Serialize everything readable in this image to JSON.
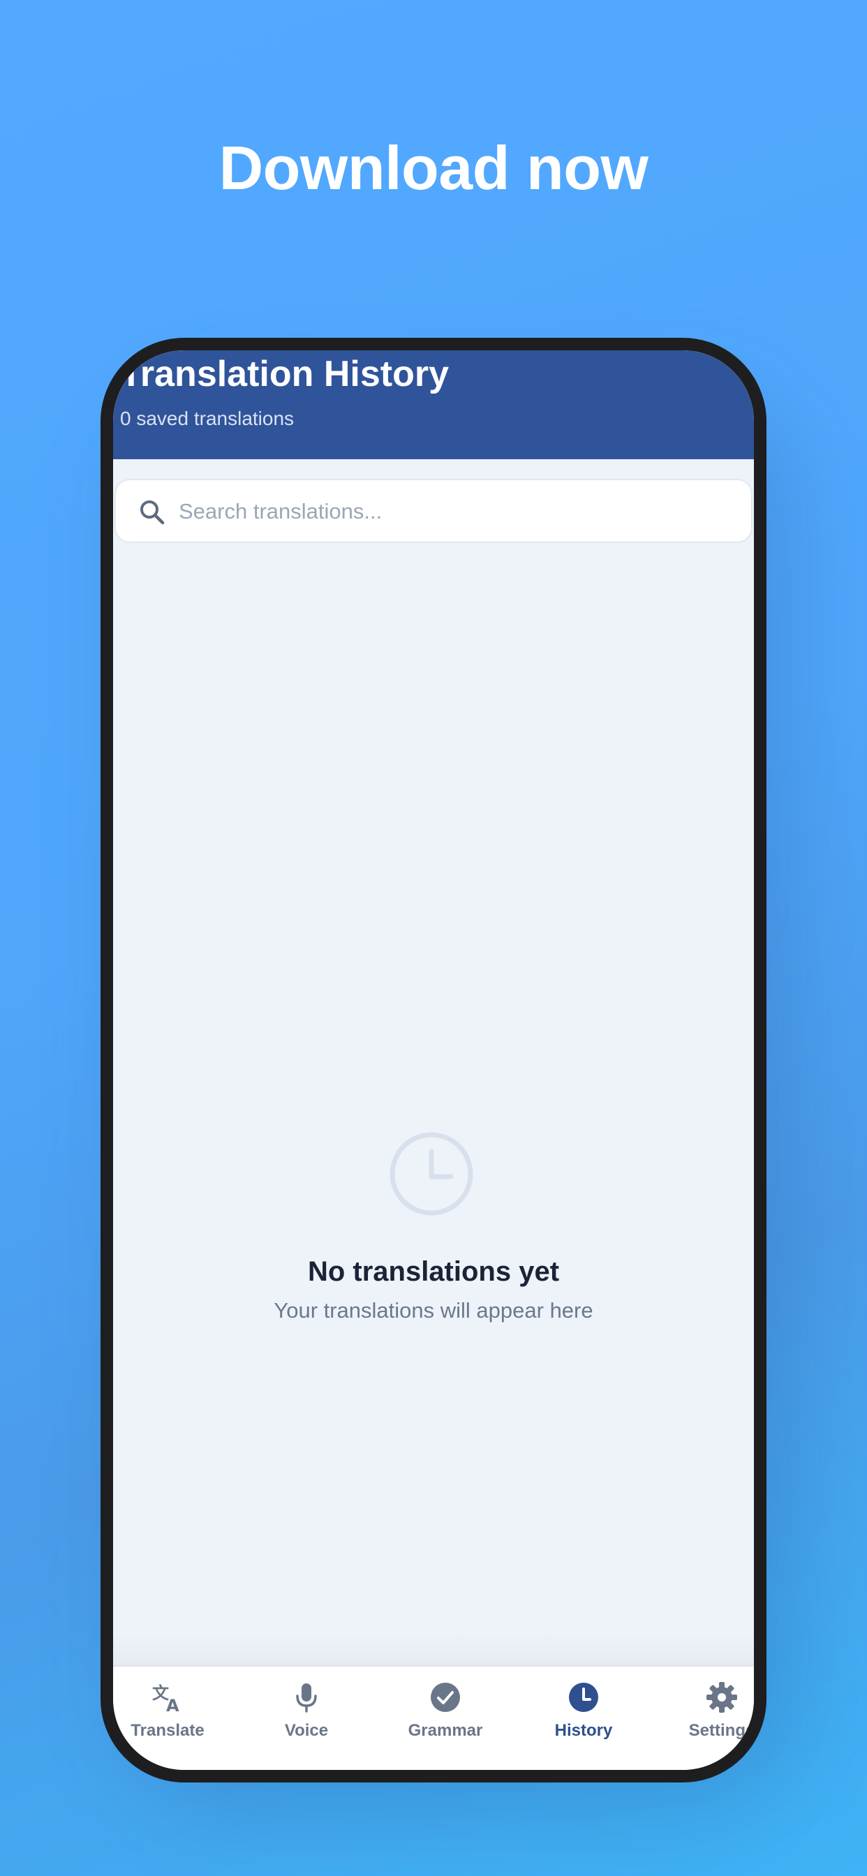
{
  "promo": {
    "headline": "Download now"
  },
  "header": {
    "title": "Translation History",
    "subtitle": "0 saved translations"
  },
  "search": {
    "placeholder": "Search translations...",
    "value": ""
  },
  "empty_state": {
    "icon": "clock-icon",
    "title": "No translations yet",
    "message": "Your translations will appear here"
  },
  "tabs": [
    {
      "label": "Translate",
      "icon": "translate-icon",
      "active": false
    },
    {
      "label": "Voice",
      "icon": "microphone-icon",
      "active": false
    },
    {
      "label": "Grammar",
      "icon": "check-circle-icon",
      "active": false
    },
    {
      "label": "History",
      "icon": "clock-icon",
      "active": true
    },
    {
      "label": "Settings",
      "icon": "gear-icon",
      "active": false
    }
  ],
  "colors": {
    "header_bg": "#30549a",
    "active_tab": "#2f4f8f",
    "inactive_tab": "#6b7588",
    "background_blue": "#52a9ff"
  }
}
